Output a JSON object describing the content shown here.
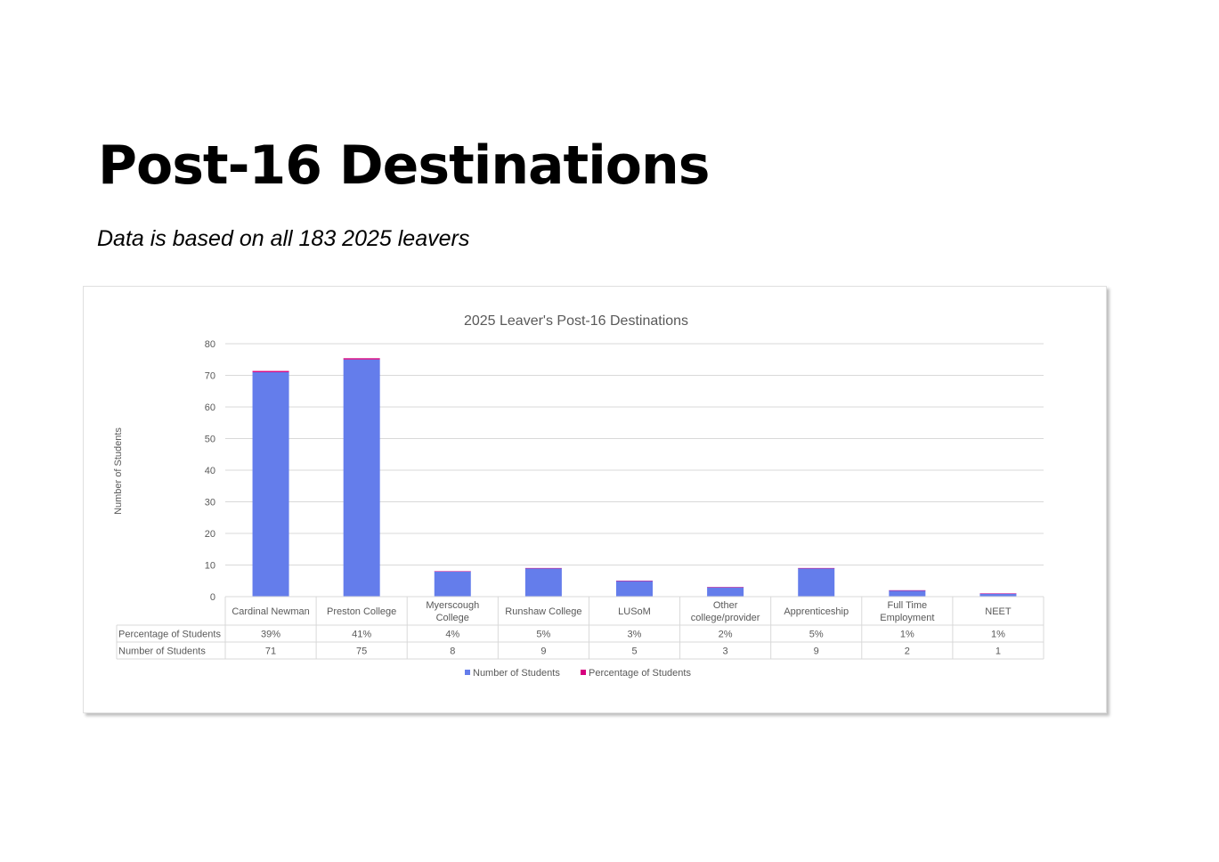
{
  "page": {
    "title": "Post-16 Destinations",
    "subtitle": "Data is based on all 183 2025 leavers"
  },
  "chart_data": {
    "type": "bar",
    "stacked": true,
    "title": "2025 Leaver's Post-16 Destinations",
    "ylabel": "Number of Students",
    "xlabel": "",
    "ylim": [
      0,
      80
    ],
    "yticks": [
      0,
      10,
      20,
      30,
      40,
      50,
      60,
      70,
      80
    ],
    "grid": true,
    "legend_position": "bottom",
    "data_table": true,
    "categories": [
      [
        "Cardinal Newman"
      ],
      [
        "Preston College"
      ],
      [
        "Myerscough",
        "College"
      ],
      [
        "Runshaw College"
      ],
      [
        "LUSoM"
      ],
      [
        "Other",
        "college/provider"
      ],
      [
        "Apprenticeship"
      ],
      [
        "Full Time",
        "Employment"
      ],
      [
        "NEET"
      ]
    ],
    "series": [
      {
        "name": "Number of Students",
        "color": "#647deb",
        "values": [
          71,
          75,
          8,
          9,
          5,
          3,
          9,
          2,
          1
        ],
        "labels": [
          "71",
          "75",
          "8",
          "9",
          "5",
          "3",
          "9",
          "2",
          "1"
        ]
      },
      {
        "name": "Percentage of Students",
        "color": "#d6007e",
        "values": [
          0.39,
          0.41,
          0.04,
          0.05,
          0.03,
          0.02,
          0.05,
          0.01,
          0.01
        ],
        "labels": [
          "39%",
          "41%",
          "4%",
          "5%",
          "3%",
          "2%",
          "5%",
          "1%",
          "1%"
        ]
      }
    ]
  }
}
